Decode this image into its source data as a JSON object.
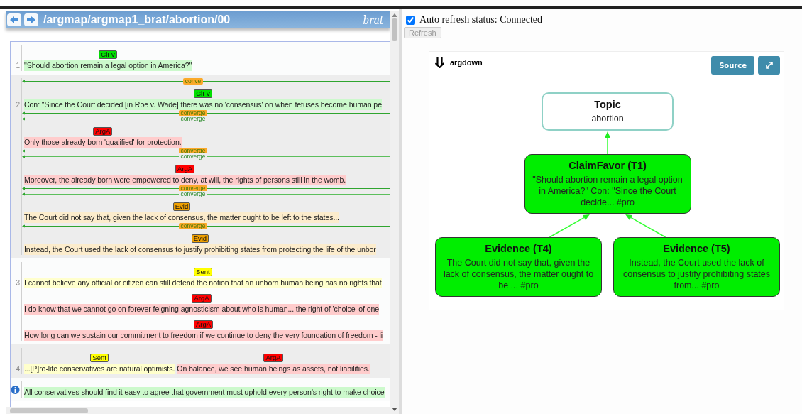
{
  "header": {
    "title": "/argmap/argmap1_brat/abortion/00",
    "brand": "brat"
  },
  "document": {
    "blocks": [
      {
        "number": "1",
        "items": [
          {
            "kind": "spans",
            "spans": [
              {
                "label": "ClFv",
                "color": "#00e000",
                "text": "\"Should abortion remain a legal option in America?\""
              }
            ]
          }
        ]
      },
      {
        "number": "2",
        "items": [
          {
            "kind": "arc",
            "label": "conve",
            "boxed": true
          },
          {
            "kind": "spans",
            "spans": [
              {
                "label": "ClFv",
                "color": "#00e000",
                "text": "Con: \"Since the Court decided [in Roe v. Wade] there was no 'consensus' on when fetuses become human pe"
              }
            ]
          },
          {
            "kind": "arc",
            "label": "converge",
            "boxed": true
          },
          {
            "kind": "arc",
            "label": "converge",
            "boxed": false
          },
          {
            "kind": "spans",
            "spans": [
              {
                "label": "ArgA",
                "color": "#ff0000",
                "text": "Only those already born 'qualified' for protection."
              }
            ]
          },
          {
            "kind": "arc",
            "label": "converge",
            "boxed": true
          },
          {
            "kind": "arc",
            "label": "converge",
            "boxed": false
          },
          {
            "kind": "spans",
            "spans": [
              {
                "label": "ArgA",
                "color": "#ff0000",
                "text": "Moreover, the already born were empowered to deny, at will, the rights of persons still in the womb."
              }
            ]
          },
          {
            "kind": "arc",
            "label": "converge",
            "boxed": true
          },
          {
            "kind": "arc",
            "label": "converge",
            "boxed": false
          },
          {
            "kind": "spans",
            "spans": [
              {
                "label": "Evid",
                "color": "#f0a000",
                "text": "The Court did not say that, given the lack of consensus, the matter ought to be left to the states..."
              }
            ]
          },
          {
            "kind": "arc",
            "label": "converge",
            "boxed": true
          },
          {
            "kind": "spans",
            "spans": [
              {
                "label": "Evid",
                "color": "#f0a000",
                "text": "Instead, the Court used the lack of consensus to justify prohibiting states from protecting the life of the unbor"
              }
            ]
          }
        ]
      },
      {
        "number": "3",
        "items": [
          {
            "kind": "spans",
            "spans": [
              {
                "label": "Sent",
                "color": "#ffff00",
                "text": "I cannot believe any official or citizen can still defend the notion that an unborn human being has no rights that"
              }
            ]
          },
          {
            "kind": "spans",
            "spans": [
              {
                "label": "ArgA",
                "color": "#ff0000",
                "text": "I do know that we cannot go on forever feigning agnosticism about who is human... the right of 'choice' of one"
              }
            ]
          },
          {
            "kind": "spans",
            "spans": [
              {
                "label": "ArgA",
                "color": "#ff0000",
                "text": "How long can we sustain our commitment to freedom if we continue to deny the very foundation of freedom - li"
              }
            ]
          }
        ]
      },
      {
        "number": "4",
        "items": [
          {
            "kind": "spans",
            "spans": [
              {
                "label": "Sent",
                "color": "#ffff00",
                "text": "...[P]ro-life conservatives are natural optimists."
              },
              {
                "label": "ArgA",
                "color": "#ff0000",
                "text": "On balance, we see human beings as assets, not liabilities."
              }
            ]
          }
        ]
      },
      {
        "flagged": true,
        "items": [
          {
            "kind": "spans",
            "spans": [
              {
                "color": "#ccf9cc",
                "text": "All conservatives should find it easy to agree that government must uphold every person’s right to make choice"
              }
            ]
          }
        ]
      }
    ]
  },
  "sidebar": {
    "auto_refresh": {
      "checked": true,
      "label": "Auto refresh status: Connected"
    },
    "refresh_button": {
      "label": "Refresh",
      "disabled": true
    },
    "argdown": {
      "name": "argdown",
      "source_button": "Source",
      "graph": {
        "kind": "topic",
        "title": "Topic",
        "text": "abortion",
        "children": [
          {
            "kind": "statement",
            "title": "ClaimFavor (T1)",
            "text": "\"Should abortion remain a legal option in America?\" Con: \"Since the Court decide... #pro",
            "children": [
              {
                "kind": "statement",
                "title": "Evidence (T4)",
                "text": "The Court did not say that, given the lack of consensus, the matter ought to be ... #pro"
              },
              {
                "kind": "statement",
                "title": "Evidence (T5)",
                "text": "Instead, the Court used the lack of consensus to justify prohibiting states from... #pro"
              }
            ]
          }
        ]
      }
    }
  }
}
